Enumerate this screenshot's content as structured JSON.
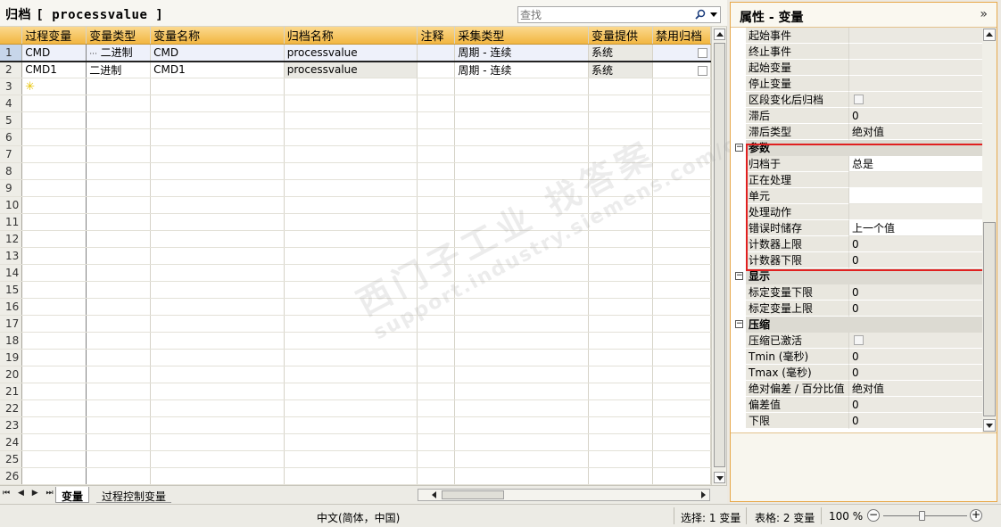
{
  "editor": {
    "title_prefix": "归档",
    "title_name": "[ processvalue ]",
    "search_placeholder": "查找",
    "columns": [
      "过程变量",
      "变量类型",
      "变量名称",
      "归档名称",
      "注释",
      "采集类型",
      "变量提供",
      "禁用归档"
    ],
    "rows": [
      {
        "num": "1",
        "process_var": "CMD",
        "var_type": "二进制",
        "var_name": "CMD",
        "archive_name": "processvalue",
        "comment": "",
        "acq_type": "周期 - 连续",
        "provider": "系统"
      },
      {
        "num": "2",
        "process_var": "CMD1",
        "var_type": "二进制",
        "var_name": "CMD1",
        "archive_name": "processvalue",
        "comment": "",
        "acq_type": "周期 - 连续",
        "provider": "系统"
      }
    ],
    "empty_row_numbers": [
      "3",
      "4",
      "5",
      "6",
      "7",
      "8",
      "9",
      "10",
      "11",
      "12",
      "13",
      "14",
      "15",
      "16",
      "17",
      "18",
      "19",
      "20",
      "21",
      "22",
      "23",
      "24",
      "25",
      "26"
    ],
    "new_row_icon": "asterisk-new-row-icon",
    "tabs": [
      "变量",
      "过程控制变量"
    ],
    "nav_buttons": "⏮ ◀ ▶ ⏭"
  },
  "properties": {
    "title": "属性 - 变量",
    "pin_icon": "double-chevron-icon",
    "rows_top": [
      {
        "name": "起始事件",
        "value": ""
      },
      {
        "name": "终止事件",
        "value": ""
      },
      {
        "name": "起始变量",
        "value": ""
      },
      {
        "name": "停止变量",
        "value": ""
      },
      {
        "name": "区段变化后归档",
        "value": "",
        "checkbox": true
      },
      {
        "name": "滞后",
        "value": "0"
      },
      {
        "name": "滞后类型",
        "value": "绝对值"
      }
    ],
    "section_params": "参数",
    "rows_params": [
      {
        "name": "归档于",
        "value": "总是"
      },
      {
        "name": "正在处理",
        "value": ""
      },
      {
        "name": "单元",
        "value": ""
      },
      {
        "name": "处理动作",
        "value": ""
      },
      {
        "name": "错误时储存",
        "value": "上一个值"
      },
      {
        "name": "计数器上限",
        "value": "0"
      },
      {
        "name": "计数器下限",
        "value": "0"
      }
    ],
    "section_display": "显示",
    "rows_display": [
      {
        "name": "标定变量下限",
        "value": "0"
      },
      {
        "name": "标定变量上限",
        "value": "0"
      }
    ],
    "section_compress": "压缩",
    "rows_compress": [
      {
        "name": "压缩已激活",
        "value": "",
        "checkbox": true
      },
      {
        "name": "Tmin (毫秒)",
        "value": "0"
      },
      {
        "name": "Tmax (毫秒)",
        "value": "0"
      },
      {
        "name": "绝对偏差 / 百分比值",
        "value": "绝对值"
      },
      {
        "name": "偏差值",
        "value": "0"
      },
      {
        "name": "下限",
        "value": "0"
      }
    ]
  },
  "status": {
    "language": "中文(简体，中国)",
    "selection": "选择: 1 变量",
    "table": "表格: 2 变量",
    "zoom": "100 %"
  },
  "watermark": "西门子工业  找答案",
  "watermark_url": "support.industry.siemens.com/cs",
  "colors": {
    "header_orange": "#f2b641",
    "highlight_red": "#e02020",
    "panel_border": "#e7a84a"
  }
}
